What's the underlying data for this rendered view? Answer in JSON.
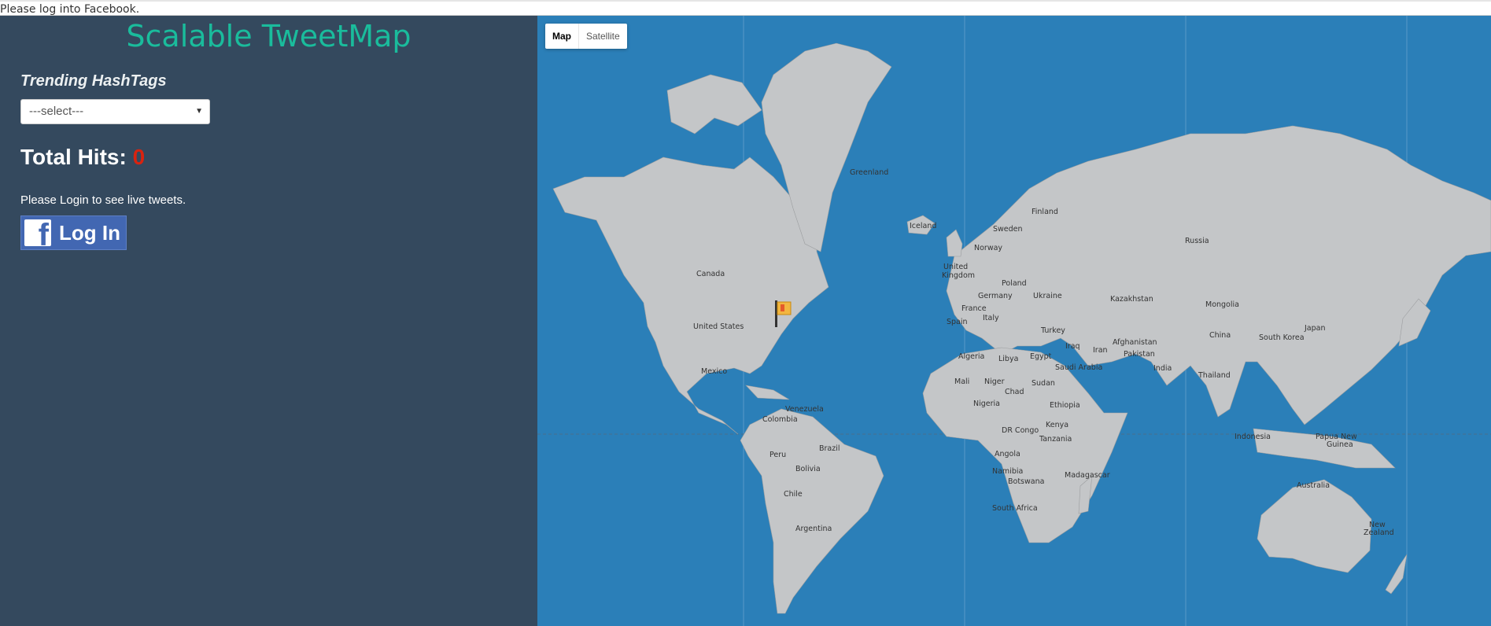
{
  "status_bar": {
    "text": "Please log into Facebook."
  },
  "sidebar": {
    "title": "Scalable TweetMap",
    "trending_label": "Trending HashTags",
    "hashtag_select": {
      "selected": "---select---"
    },
    "total_hits": {
      "label": "Total Hits:",
      "value": "0"
    },
    "login_message": "Please Login to see live tweets.",
    "fb_button": {
      "logo": "f",
      "label": "Log In"
    }
  },
  "map": {
    "type_control": {
      "map_label": "Map",
      "satellite_label": "Satellite",
      "active": "Map"
    },
    "labels": {
      "greenland": "Greenland",
      "iceland": "Iceland",
      "canada": "Canada",
      "united_states": "United States",
      "mexico": "Mexico",
      "venezuela": "Venezuela",
      "colombia": "Colombia",
      "peru": "Peru",
      "brazil": "Brazil",
      "bolivia": "Bolivia",
      "chile": "Chile",
      "argentina": "Argentina",
      "finland": "Finland",
      "sweden": "Sweden",
      "norway": "Norway",
      "united": "United",
      "kingdom": "Kingdom",
      "poland": "Poland",
      "germany": "Germany",
      "ukraine": "Ukraine",
      "france": "France",
      "italy": "Italy",
      "spain": "Spain",
      "turkey": "Turkey",
      "russia": "Russia",
      "kazakhstan": "Kazakhstan",
      "mongolia": "Mongolia",
      "china": "China",
      "south_korea": "South Korea",
      "japan": "Japan",
      "afghanistan": "Afghanistan",
      "pakistan": "Pakistan",
      "iraq": "Iraq",
      "iran": "Iran",
      "saudi_arabia": "Saudi Arabia",
      "india": "India",
      "thailand": "Thailand",
      "algeria": "Algeria",
      "libya": "Libya",
      "egypt": "Egypt",
      "mali": "Mali",
      "niger": "Niger",
      "chad": "Chad",
      "sudan": "Sudan",
      "nigeria": "Nigeria",
      "ethiopia": "Ethiopia",
      "dr_congo": "DR Congo",
      "kenya": "Kenya",
      "tanzania": "Tanzania",
      "angola": "Angola",
      "namibia": "Namibia",
      "botswana": "Botswana",
      "madagascar": "Madagascar",
      "south_africa": "South Africa",
      "indonesia": "Indonesia",
      "papua_new": "Papua New",
      "guinea": "Guinea",
      "australia": "Australia",
      "new": "New",
      "zealand": "Zealand"
    },
    "marker_icon": "flag-icon"
  },
  "colors": {
    "sidebar_bg": "#34495e",
    "title": "#1abc9c",
    "hits_value": "#d9230f",
    "ocean": "#2b7fb8",
    "land": "#c4c6c8",
    "fb_blue": "#4267b2"
  }
}
